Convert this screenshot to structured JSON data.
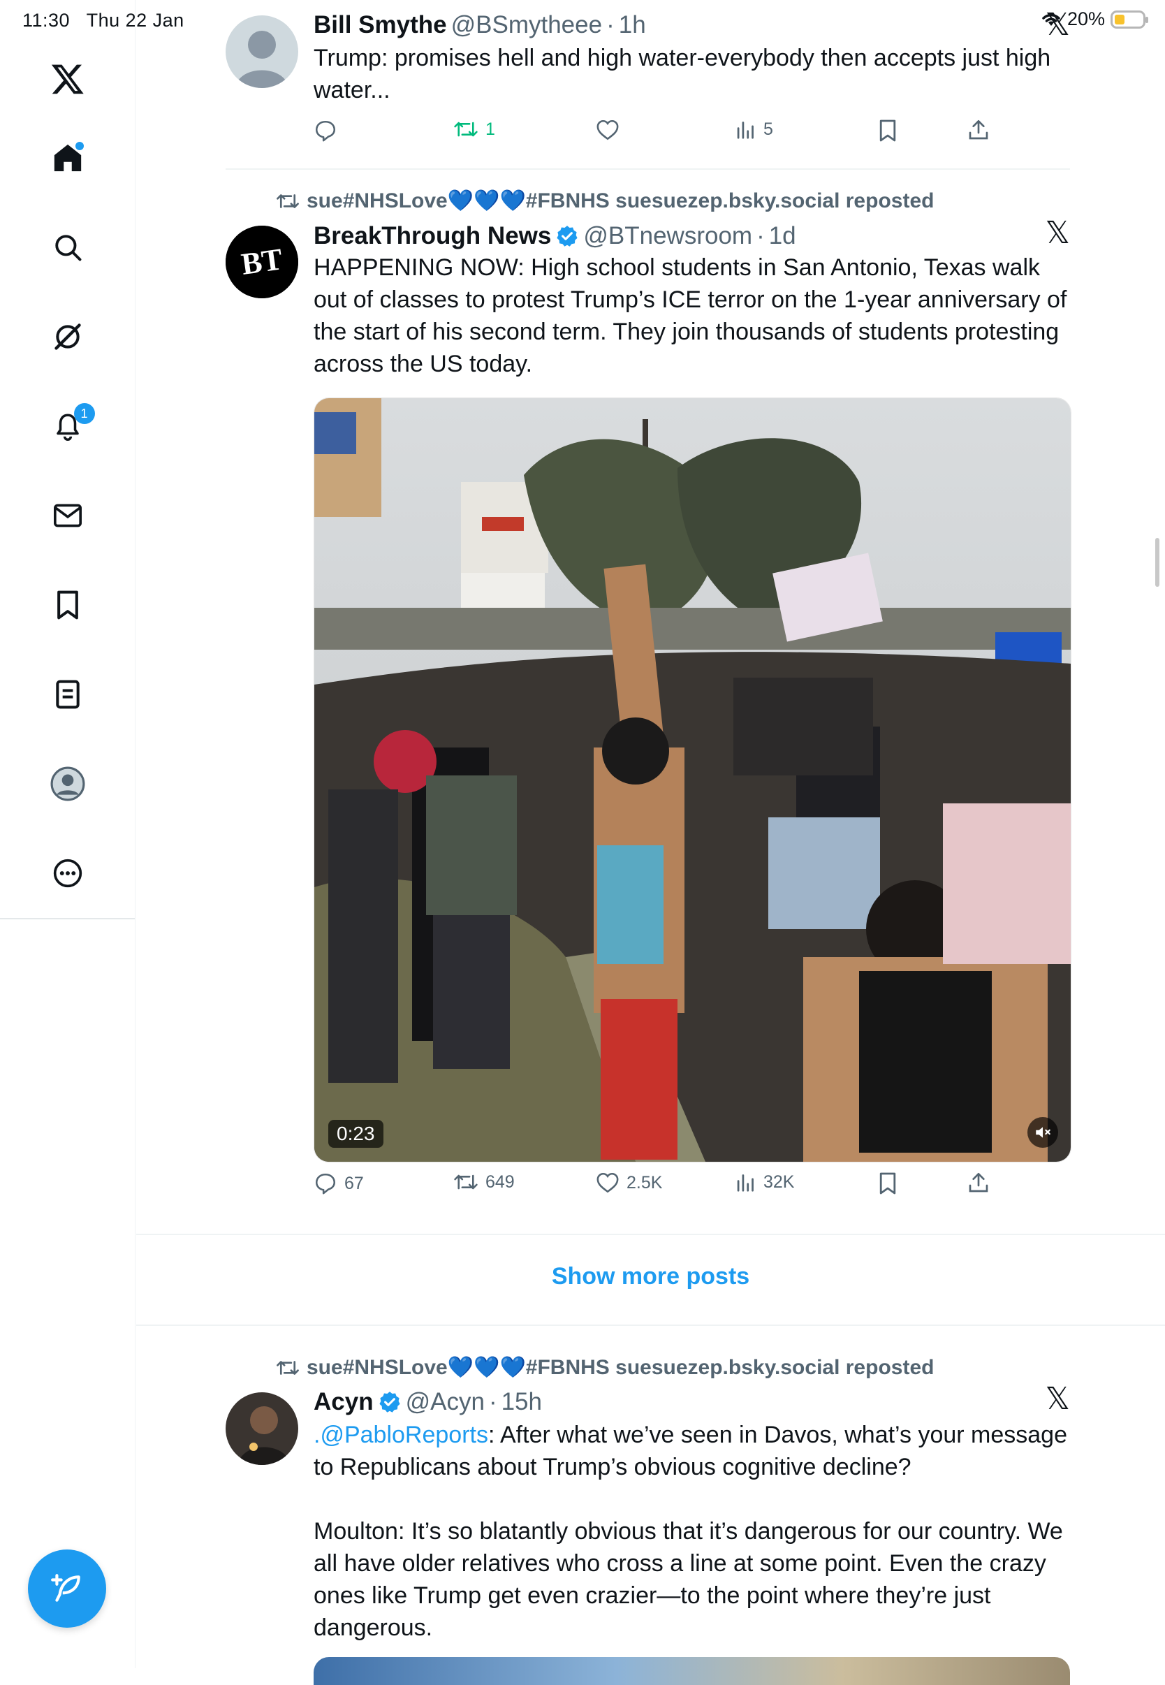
{
  "status_bar": {
    "time": "11:30",
    "date": "Thu 22 Jan",
    "battery": "20%"
  },
  "sidebar": {
    "notifications_badge": "1",
    "items": [
      "x-logo",
      "home",
      "search",
      "grok",
      "notifications",
      "messages",
      "bookmarks",
      "lists",
      "profile",
      "more"
    ]
  },
  "posts": [
    {
      "name": "Bill Smythe",
      "handle": "@BSmytheee",
      "time": "1h",
      "text": "Trump: promises hell and high water-everybody then accepts just high water...",
      "stats": {
        "replies": "",
        "reposts": "1",
        "likes": "",
        "views": "5"
      }
    },
    {
      "reposted_by": "sue#NHSLove💙💙💙#FBNHS suesuezep.bsky.social reposted",
      "name": "BreakThrough News",
      "handle": "@BTnewsroom",
      "time": "1d",
      "text": "HAPPENING NOW: High school students in San Antonio, Texas walk out of classes to protest Trump’s ICE terror on the 1-year anniversary of the start of his second term. They join thousands of students protesting across the US today.",
      "video_duration": "0:23",
      "stats": {
        "replies": "67",
        "reposts": "649",
        "likes": "2.5K",
        "views": "32K"
      }
    },
    {
      "reposted_by": "sue#NHSLove💙💙💙#FBNHS suesuezep.bsky.social reposted",
      "name": "Acyn",
      "handle": "@Acyn",
      "time": "15h",
      "mention": ".@PabloReports",
      "text_1": ": After what we’ve seen in Davos, what’s your message to Republicans about Trump’s obvious cognitive decline?",
      "text_2": "Moulton: It’s so blatantly obvious that it’s dangerous for our country. We all have older relatives who cross a line at some point. Even the crazy ones like Trump get even crazier—to the point where they’re just dangerous."
    }
  ],
  "show_more": "Show more posts",
  "colors": {
    "accent": "#1d9bf0",
    "repost_green": "#00ba7c",
    "muted": "#536471"
  }
}
